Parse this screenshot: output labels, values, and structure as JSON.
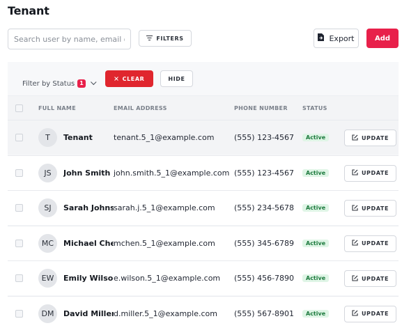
{
  "header": {
    "title": "Tenant"
  },
  "search": {
    "placeholder": "Search user by name, email or phone"
  },
  "toolbar": {
    "filters_label": "FILTERS",
    "export_label": "Export",
    "add_label": "Add"
  },
  "filter_bar": {
    "label": "Filter by Status",
    "count": "1",
    "clear_label": "CLEAR",
    "hide_label": "HIDE"
  },
  "table": {
    "columns": {
      "name": "FULL NAME",
      "email": "EMAIL ADDRESS",
      "phone": "PHONE NUMBER",
      "status": "STATUS"
    },
    "rows": [
      {
        "initials": "T",
        "name": "Tenant",
        "email": "tenant.5_1@example.com",
        "phone": "(555) 123-4567",
        "status": "Active",
        "action": "UPDATE"
      },
      {
        "initials": "JS",
        "name": "John Smith",
        "email": "john.smith.5_1@example.com",
        "phone": "(555) 123-4567",
        "status": "Active",
        "action": "UPDATE"
      },
      {
        "initials": "SJ",
        "name": "Sarah Johnson",
        "email": "sarah.j.5_1@example.com",
        "phone": "(555) 234-5678",
        "status": "Active",
        "action": "UPDATE"
      },
      {
        "initials": "MC",
        "name": "Michael Chen",
        "email": "mchen.5_1@example.com",
        "phone": "(555) 345-6789",
        "status": "Active",
        "action": "UPDATE"
      },
      {
        "initials": "EW",
        "name": "Emily Wilson",
        "email": "e.wilson.5_1@example.com",
        "phone": "(555) 456-7890",
        "status": "Active",
        "action": "UPDATE"
      },
      {
        "initials": "DM",
        "name": "David Miller",
        "email": "d.miller.5_1@example.com",
        "phone": "(555) 567-8901",
        "status": "Active",
        "action": "UPDATE"
      }
    ]
  },
  "colors": {
    "accent": "#e8204a",
    "clear": "#e0262e",
    "status_bg": "#dff5e6",
    "status_text": "#1d7a3e"
  },
  "icons": {
    "filters": "filter-lines-icon",
    "export": "file-export-icon",
    "clear": "close-icon",
    "update": "edit-icon",
    "chevron": "chevron-down-icon"
  }
}
